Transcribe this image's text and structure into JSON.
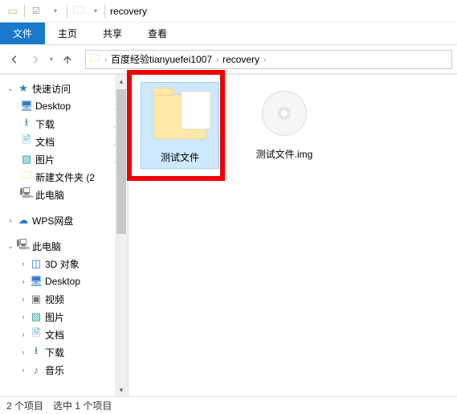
{
  "titlebar": {
    "title": "recovery"
  },
  "ribbon": {
    "file": "文件",
    "home": "主页",
    "share": "共享",
    "view": "查看"
  },
  "breadcrumbs": {
    "sep": "›",
    "items": [
      "百度经验tianyuefei1007",
      "recovery"
    ]
  },
  "sidebar": {
    "quick_access": "快速访问",
    "items": [
      {
        "label": "Desktop",
        "pin": true
      },
      {
        "label": "下载",
        "pin": true
      },
      {
        "label": "文档",
        "pin": true
      },
      {
        "label": "图片",
        "pin": true
      },
      {
        "label": "新建文件夹 (2",
        "pin": false
      },
      {
        "label": "此电脑",
        "pin": false
      }
    ],
    "wps": "WPS网盘",
    "this_pc": "此电脑",
    "pc_items": [
      {
        "label": "3D 对象"
      },
      {
        "label": "Desktop"
      },
      {
        "label": "视频"
      },
      {
        "label": "图片"
      },
      {
        "label": "文档"
      },
      {
        "label": "下载"
      },
      {
        "label": "音乐"
      }
    ]
  },
  "content": {
    "items": [
      {
        "label": "测试文件",
        "type": "folder",
        "selected": true
      },
      {
        "label": "测试文件.img",
        "type": "disc",
        "selected": false
      }
    ]
  },
  "statusbar": {
    "count": "2 个项目",
    "selected": "选中 1 个项目"
  }
}
